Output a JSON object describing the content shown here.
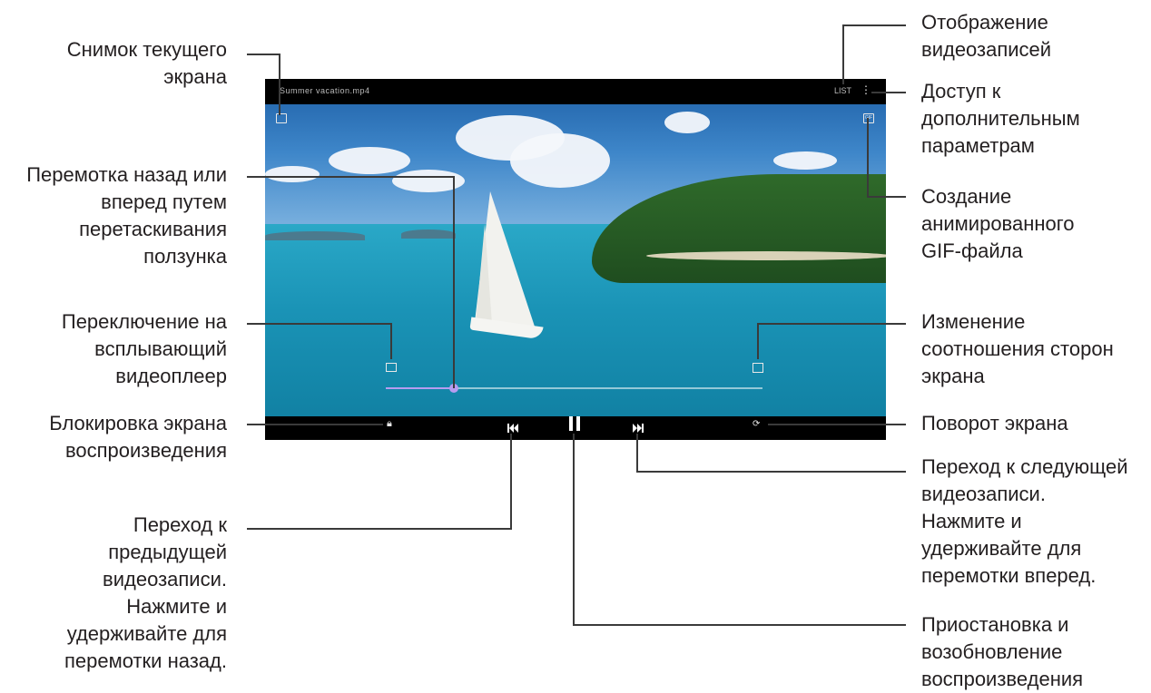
{
  "annotations": {
    "screenshot": "Снимок текущего\nэкрана",
    "seek": "Перемотка назад или\nвперед путем\nперетаскивания\nползунка",
    "popup": "Переключение на\nвсплывающий\nвидеоплеер",
    "lock": "Блокировка экрана\nвоспроизведения",
    "prev": "Переход к\nпредыдущей\nвидеозаписи.\nНажмите и\nудерживайте для\nперемотки назад.",
    "videos": "Отображение\nвидеозаписей",
    "more": "Доступ к\nдополнительным\nпараметрам",
    "gif": "Создание\nанимированного\nGIF-файла",
    "ratio": "Изменение\nсоотношения сторон\nэкрана",
    "rotate": "Поворот экрана",
    "next": "Переход к следующей\nвидеозаписи.\nНажмите и\nудерживайте для\nперемотки вперед.",
    "pause": "Приостановка и\nвозобновление\nвоспроизведения"
  },
  "player": {
    "title": "Summer vacation.mp4",
    "videos_label": "LIST",
    "progress": 0.18,
    "icons": {
      "screenshot": "screenshot-icon",
      "more": "more-options-icon",
      "gif": "gif-icon",
      "popup": "popup-player-icon",
      "ratio": "aspect-ratio-icon",
      "lock": "lock-icon",
      "prev": "skip-previous-icon",
      "pause": "pause-icon",
      "next": "skip-next-icon",
      "rotate": "rotate-icon"
    },
    "colors": {
      "accent": "#b79cf0",
      "bar": "#000000"
    }
  }
}
